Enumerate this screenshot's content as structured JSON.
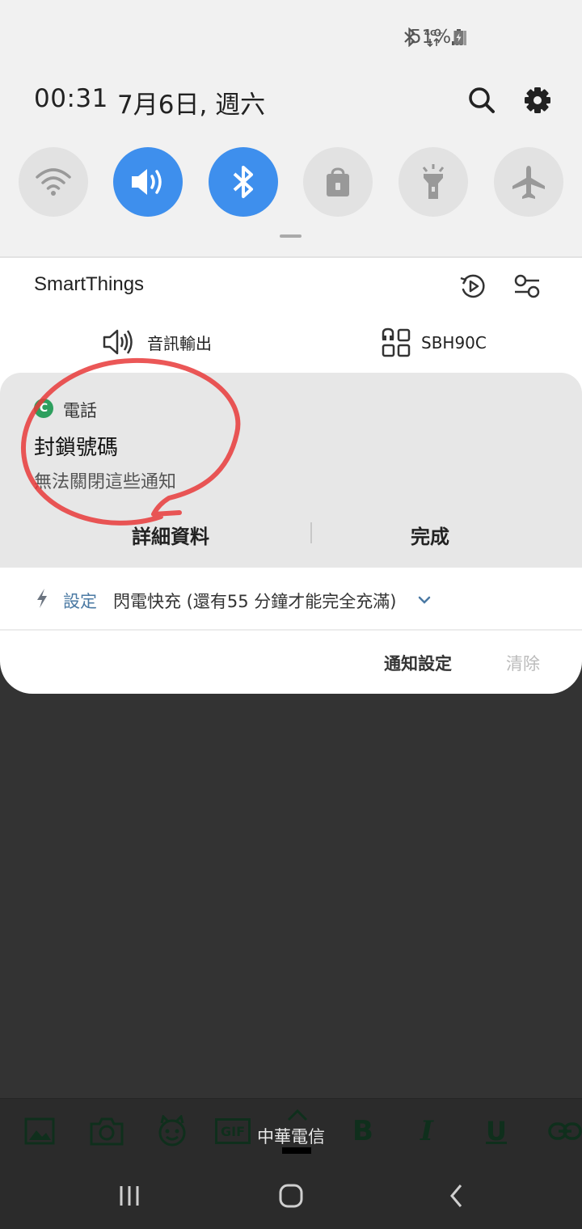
{
  "status_bar": {
    "bluetooth_icon": "bluetooth-icon",
    "network": "4G+",
    "signal_icon": "signal-icon",
    "battery_percent": "51%",
    "battery_icon": "battery-charging-icon"
  },
  "header": {
    "time": "00:31",
    "date": "7月6日, 週六",
    "search_icon": "search-icon",
    "settings_icon": "gear-icon"
  },
  "quick_settings": [
    {
      "name": "wifi",
      "icon": "wifi-icon",
      "active": false
    },
    {
      "name": "sound",
      "icon": "volume-icon",
      "active": true
    },
    {
      "name": "bluetooth",
      "icon": "bluetooth-icon",
      "active": true
    },
    {
      "name": "rotation-lock",
      "icon": "lock-icon",
      "active": false
    },
    {
      "name": "flashlight",
      "icon": "flashlight-icon",
      "active": false
    },
    {
      "name": "airplane",
      "icon": "airplane-icon",
      "active": false
    }
  ],
  "colors": {
    "accent": "#3e8fed",
    "panel_bg": "#f1f1f1",
    "notif_bg": "#e7e7e7",
    "annotation_red": "#e83a3a",
    "phone_app_green": "#2e9f5e"
  },
  "smartthings": {
    "title": "SmartThings",
    "media_output_label": "音訊輸出",
    "device_label": "SBH90C"
  },
  "notification": {
    "app_icon_letter": "C",
    "app_name": "電話",
    "title": "封鎖號碼",
    "text": "無法關閉這些通知",
    "action_details": "詳細資料",
    "action_done": "完成"
  },
  "charging": {
    "settings_label": "設定",
    "message": "閃電快充 (還有55 分鐘才能完全充滿)"
  },
  "footer": {
    "notification_settings": "通知設定",
    "clear": "清除"
  },
  "toolbar": {
    "gif_label": "GIF",
    "bold_label": "B",
    "italic_label": "I",
    "underline_label": "U",
    "carrier": "中華電信"
  }
}
